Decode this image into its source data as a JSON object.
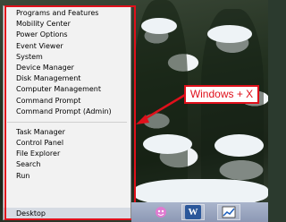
{
  "menu": {
    "group1": [
      "Programs and Features",
      "Mobility Center",
      "Power Options",
      "Event Viewer",
      "System",
      "Device Manager",
      "Disk Management",
      "Computer Management",
      "Command Prompt",
      "Command Prompt (Admin)"
    ],
    "group2": [
      "Task Manager",
      "Control Panel",
      "File Explorer",
      "Search",
      "Run"
    ],
    "desktop": "Desktop"
  },
  "callout": {
    "label": "Windows + X"
  },
  "taskbar": {
    "icons": [
      "messenger-icon",
      "word-icon",
      "chart-app-icon"
    ],
    "word_glyph": "W"
  },
  "colors": {
    "accent": "#e0101b",
    "menu_bg": "#f2f2f2",
    "taskbar": "#9aa6c0"
  }
}
